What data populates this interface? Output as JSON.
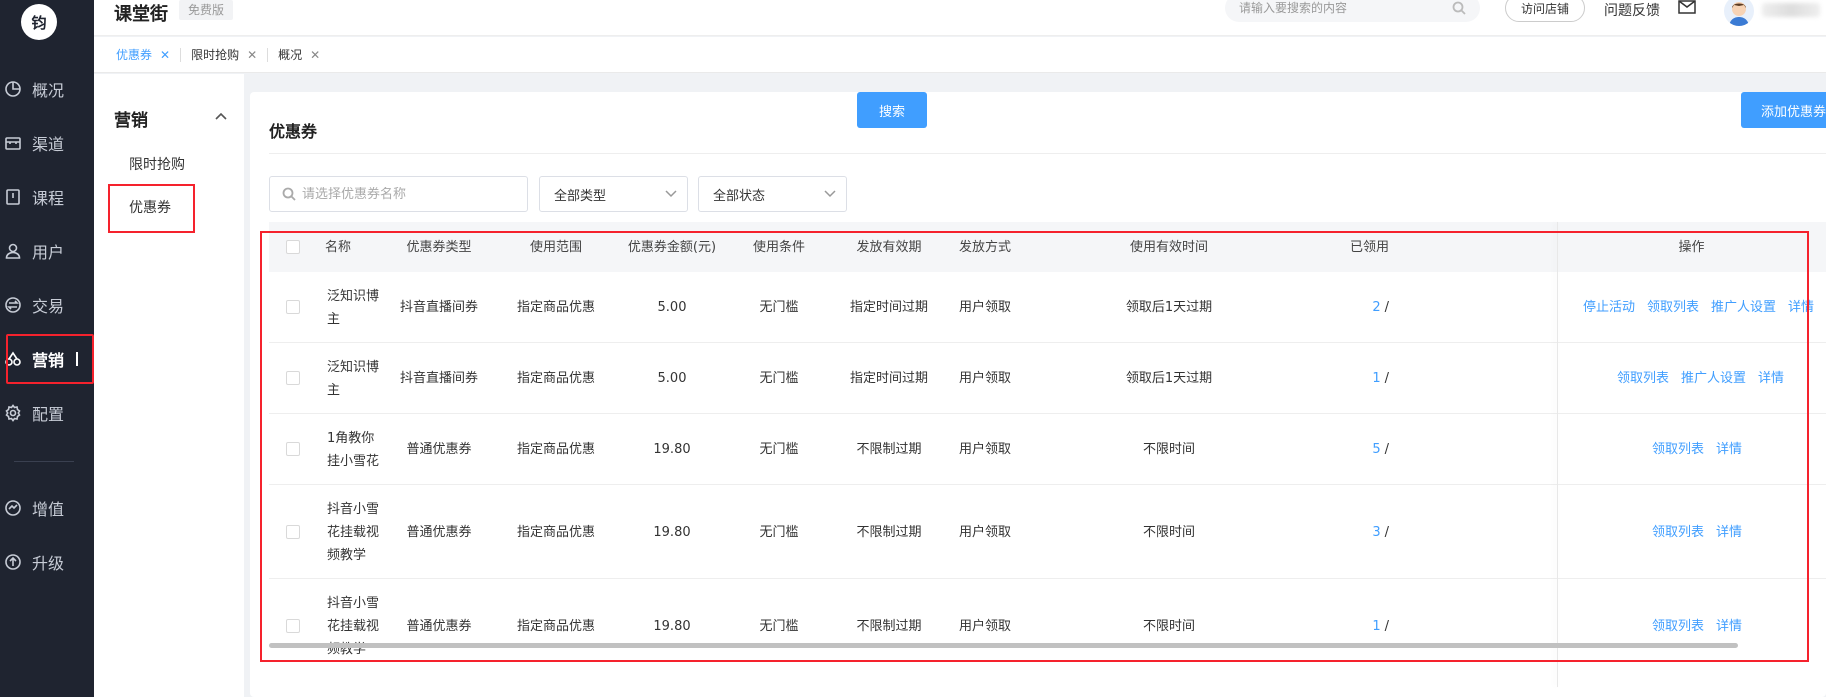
{
  "app": {
    "logo_text": "钧",
    "title": "课堂街",
    "plan_badge": "免费版"
  },
  "header": {
    "search_placeholder": "请输入要搜索的内容",
    "visit_store": "访问店铺",
    "feedback": "问题反馈"
  },
  "nav": {
    "items": [
      {
        "label": "概况",
        "icon": "pie-chart-icon"
      },
      {
        "label": "渠道",
        "icon": "store-icon"
      },
      {
        "label": "课程",
        "icon": "book-icon"
      },
      {
        "label": "用户",
        "icon": "user-icon"
      },
      {
        "label": "交易",
        "icon": "exchange-icon"
      },
      {
        "label": "营销",
        "icon": "marketing-icon",
        "active": true
      },
      {
        "label": "配置",
        "icon": "gear-icon"
      },
      {
        "label": "增值",
        "icon": "value-added-icon"
      },
      {
        "label": "升级",
        "icon": "upgrade-icon"
      }
    ]
  },
  "tabs": [
    {
      "label": "优惠券",
      "active": true
    },
    {
      "label": "限时抢购"
    },
    {
      "label": "概况"
    }
  ],
  "submenu": {
    "title": "营销",
    "items": [
      {
        "label": "限时抢购"
      },
      {
        "label": "优惠券",
        "active": true
      }
    ]
  },
  "page": {
    "title": "优惠券",
    "filters": {
      "name_placeholder": "请选择优惠券名称",
      "type_select": "全部类型",
      "status_select": "全部状态",
      "search_button": "搜索",
      "add_button": "添加优惠券"
    }
  },
  "table": {
    "headers": [
      "名称",
      "优惠券类型",
      "使用范围",
      "优惠券金额(元)",
      "使用条件",
      "发放有效期",
      "发放方式",
      "使用有效时间",
      "已领用",
      "操作"
    ],
    "rows": [
      {
        "name": "泛知识博主",
        "type": "抖音直播间券",
        "scope": "指定商品优惠",
        "amount": "5.00",
        "condition": "无门槛",
        "issue_validity": "指定时间过期",
        "issue_method": "用户领取",
        "use_validity": "领取后1天过期",
        "claimed": "2",
        "actions": [
          "停止活动",
          "领取列表",
          "推广人设置",
          "详情"
        ]
      },
      {
        "name": "泛知识博主",
        "type": "抖音直播间券",
        "scope": "指定商品优惠",
        "amount": "5.00",
        "condition": "无门槛",
        "issue_validity": "指定时间过期",
        "issue_method": "用户领取",
        "use_validity": "领取后1天过期",
        "claimed": "1",
        "actions": [
          "领取列表",
          "推广人设置",
          "详情"
        ]
      },
      {
        "name": "1角教你挂小雪花",
        "type": "普通优惠券",
        "scope": "指定商品优惠",
        "amount": "19.80",
        "condition": "无门槛",
        "issue_validity": "不限制过期",
        "issue_method": "用户领取",
        "use_validity": "不限时间",
        "claimed": "5",
        "actions": [
          "领取列表",
          "详情"
        ]
      },
      {
        "name": "抖音小雪花挂载视频教学",
        "type": "普通优惠券",
        "scope": "指定商品优惠",
        "amount": "19.80",
        "condition": "无门槛",
        "issue_validity": "不限制过期",
        "issue_method": "用户领取",
        "use_validity": "不限时间",
        "claimed": "3",
        "actions": [
          "领取列表",
          "详情"
        ]
      },
      {
        "name": "抖音小雪花挂载视频教学",
        "type": "普通优惠券",
        "scope": "指定商品优惠",
        "amount": "19.80",
        "condition": "无门槛",
        "issue_validity": "不限制过期",
        "issue_method": "用户领取",
        "use_validity": "不限时间",
        "claimed": "1",
        "actions": [
          "领取列表",
          "详情"
        ]
      }
    ]
  },
  "colors": {
    "accent": "#409eff",
    "nav_bg": "#1f2430",
    "highlight_box": "#f5222d"
  }
}
